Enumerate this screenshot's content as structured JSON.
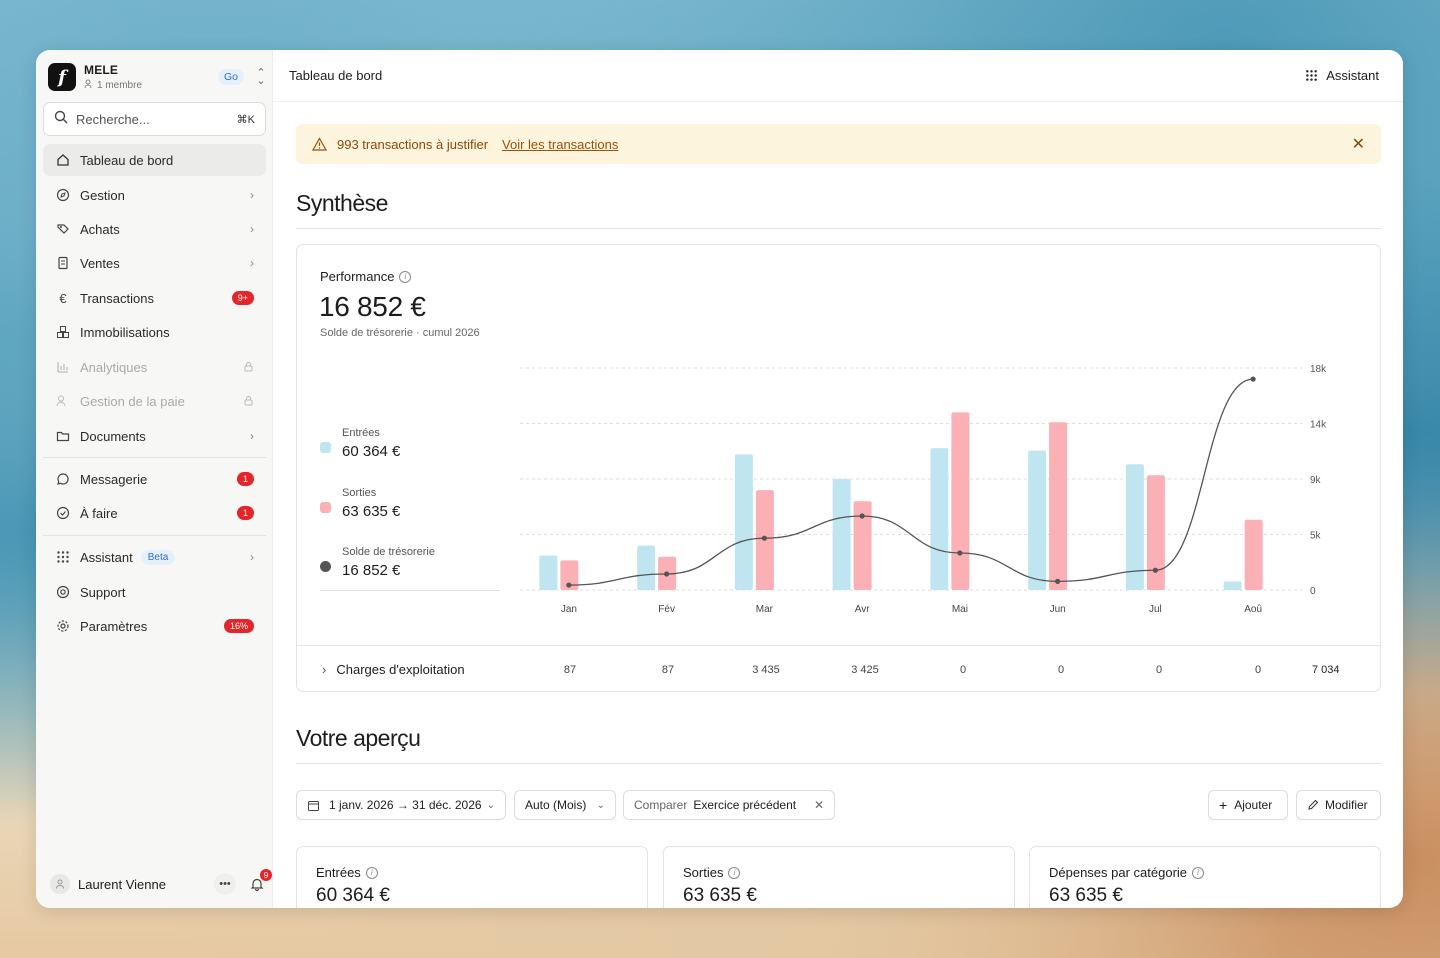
{
  "workspace": {
    "name": "MELE",
    "members": "1 membre",
    "plan": "Go"
  },
  "search": {
    "placeholder": "Recherche...",
    "shortcut": "⌘K"
  },
  "sidebar": {
    "items": [
      {
        "label": "Tableau de bord"
      },
      {
        "label": "Gestion"
      },
      {
        "label": "Achats"
      },
      {
        "label": "Ventes"
      },
      {
        "label": "Transactions",
        "badge": "9+"
      },
      {
        "label": "Immobilisations"
      },
      {
        "label": "Analytiques"
      },
      {
        "label": "Gestion de la paie"
      },
      {
        "label": "Documents"
      },
      {
        "label": "Messagerie",
        "badge": "1"
      },
      {
        "label": "À faire",
        "badge": "1"
      },
      {
        "label": "Assistant",
        "tag": "Beta"
      },
      {
        "label": "Support"
      },
      {
        "label": "Paramètres",
        "badge": "16%"
      }
    ]
  },
  "user": {
    "name": "Laurent Vienne",
    "notifications": "9"
  },
  "topbar": {
    "title": "Tableau de bord",
    "assistant": "Assistant"
  },
  "alert": {
    "message": "993 transactions à justifier",
    "link": "Voir les transactions"
  },
  "synthese": {
    "title": "Synthèse",
    "performance_label": "Performance",
    "performance_value": "16 852 €",
    "performance_sub": "Solde de trésorerie · cumul 2026",
    "legend": [
      {
        "name": "Entrées",
        "value": "60 364 €",
        "color": "#bfe6f0"
      },
      {
        "name": "Sorties",
        "value": "63 635 €",
        "color": "#fbb0b5"
      },
      {
        "name": "Solde de trésorerie",
        "value": "16 852 €",
        "color": "#555555"
      }
    ],
    "charges": {
      "label": "Charges d'exploitation",
      "values": [
        "87",
        "87",
        "3 435",
        "3 425",
        "0",
        "0",
        "0",
        "0"
      ],
      "total": "7 034"
    }
  },
  "chart_data": {
    "type": "bar",
    "categories": [
      "Jan",
      "Fév",
      "Mar",
      "Avr",
      "Mai",
      "Jun",
      "Jul",
      "Aoû"
    ],
    "yticks": [
      "0",
      "5k",
      "9k",
      "14k",
      "18k"
    ],
    "ylim": [
      0,
      18000
    ],
    "grid": true,
    "series": [
      {
        "name": "Entrées",
        "type": "bar",
        "color": "#bfe6f0",
        "values": [
          2800,
          3600,
          11000,
          9000,
          11500,
          11300,
          10200,
          700
        ]
      },
      {
        "name": "Sorties",
        "type": "bar",
        "color": "#fbb0b5",
        "values": [
          2400,
          2700,
          8100,
          7200,
          14400,
          13600,
          9300,
          5700
        ]
      },
      {
        "name": "Solde de trésorerie",
        "type": "line",
        "color": "#555555",
        "values": [
          400,
          1300,
          4200,
          6000,
          3000,
          700,
          1600,
          17100
        ]
      }
    ]
  },
  "apercu": {
    "title": "Votre aperçu",
    "date_range": "1 janv. 2026 → 31 déc. 2026",
    "granularity": "Auto (Mois)",
    "compare_label": "Comparer",
    "compare_value": "Exercice précédent",
    "add": "Ajouter",
    "edit": "Modifier",
    "kpis": [
      {
        "label": "Entrées",
        "value": "60 364 €"
      },
      {
        "label": "Sorties",
        "value": "63 635 €"
      },
      {
        "label": "Dépenses par catégorie",
        "value": "63 635 €"
      }
    ]
  }
}
